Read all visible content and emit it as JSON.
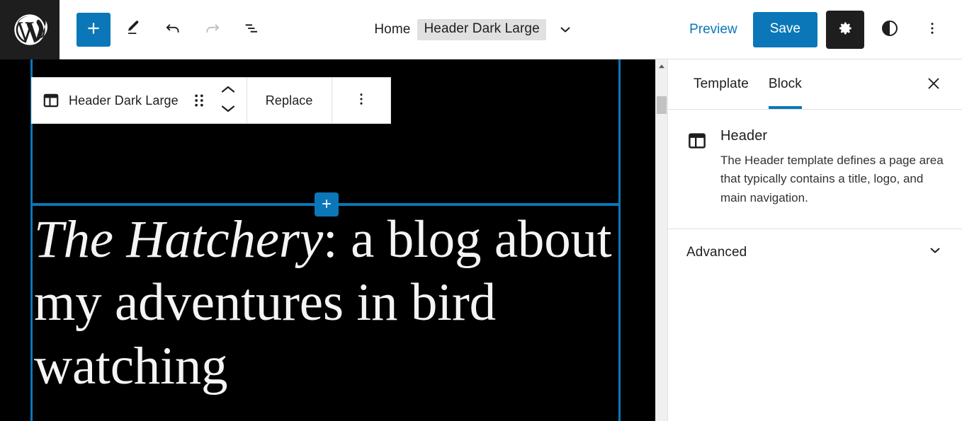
{
  "topbar": {
    "logo_icon": "wordpress-logo-icon",
    "add_label": "+",
    "add_icon": "plus-icon",
    "edit_icon": "pencil-edit-icon",
    "undo_icon": "undo-arrow-icon",
    "redo_icon": "redo-arrow-icon",
    "list_view_icon": "list-view-icon",
    "breadcrumb_home": "Home",
    "breadcrumb_current": "Header Dark Large",
    "breadcrumb_chevron_icon": "chevron-down-icon",
    "preview_label": "Preview",
    "save_label": "Save",
    "settings_icon": "gear-icon",
    "styles_icon": "contrast-half-circle-icon",
    "options_icon": "three-dots-vertical-icon"
  },
  "block_toolbar": {
    "block_icon": "template-part-header-icon",
    "block_label": "Header Dark Large",
    "drag_icon": "drag-handle-dots-icon",
    "move_up_icon": "chevron-up-icon",
    "move_down_icon": "chevron-down-icon",
    "replace_label": "Replace",
    "more_icon": "three-dots-vertical-icon"
  },
  "canvas": {
    "inserter_label": "+",
    "inserter_icon": "plus-icon",
    "title_emphasis": "The Hatchery",
    "title_rest": ": a blog about my adventures in bird watching"
  },
  "scrollbar": {
    "up_arrow_icon": "scroll-up-arrow-icon"
  },
  "sidebar": {
    "tab_template": "Template",
    "tab_block": "Block",
    "active_tab": "Block",
    "close_icon": "close-x-icon",
    "block_card": {
      "icon": "template-part-header-icon",
      "title": "Header",
      "description": "The Header template defines a page area that typically contains a title, logo, and main navigation."
    },
    "advanced_panel": {
      "label": "Advanced",
      "chevron_icon": "chevron-down-icon"
    }
  },
  "colors": {
    "accent_blue": "#0b77b8",
    "dark": "#1e1e1e",
    "canvas_bg": "#000000",
    "border": "#e0e0e0"
  }
}
